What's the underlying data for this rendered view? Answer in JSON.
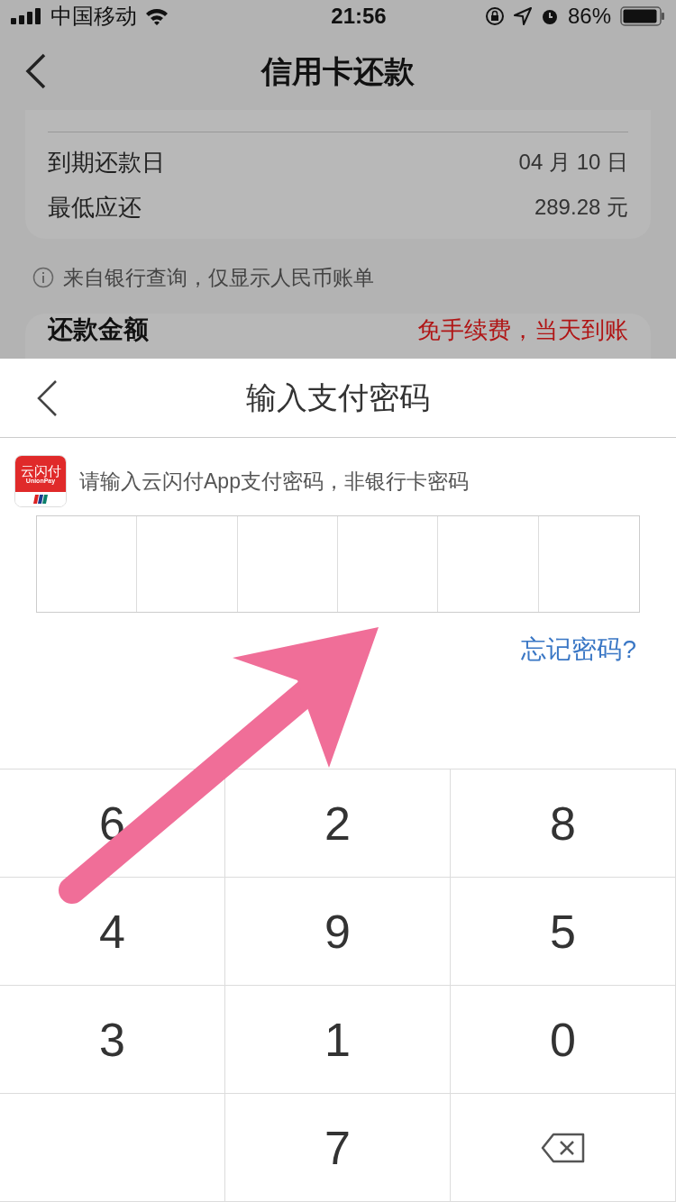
{
  "status_bar": {
    "carrier": "中国移动",
    "time": "21:56",
    "battery": "86%"
  },
  "nav": {
    "title": "信用卡还款"
  },
  "background": {
    "rows": [
      {
        "label": "到期还款日",
        "value": "04 月 10 日"
      },
      {
        "label": "最低应还",
        "value": "289.28 元"
      }
    ],
    "notice": "来自银行查询，仅显示人民币账单",
    "amount_card": {
      "title": "还款金额",
      "note": "免手续费，当天到账"
    }
  },
  "sheet": {
    "title": "输入支付密码",
    "logo": {
      "name": "云闪付",
      "subtitle": "UnionPay"
    },
    "hint": "请输入云闪付App支付密码，非银行卡密码",
    "cells": [
      {
        "filled": false
      },
      {
        "filled": false
      },
      {
        "filled": false
      },
      {
        "filled": false
      },
      {
        "filled": false
      },
      {
        "filled": false
      }
    ],
    "forgot_link": "忘记密码?"
  },
  "keypad": [
    {
      "kind": "digit",
      "label": "6"
    },
    {
      "kind": "digit",
      "label": "2"
    },
    {
      "kind": "digit",
      "label": "8"
    },
    {
      "kind": "digit",
      "label": "4"
    },
    {
      "kind": "digit",
      "label": "9"
    },
    {
      "kind": "digit",
      "label": "5"
    },
    {
      "kind": "digit",
      "label": "3"
    },
    {
      "kind": "digit",
      "label": "1"
    },
    {
      "kind": "digit",
      "label": "0"
    },
    {
      "kind": "blank"
    },
    {
      "kind": "digit",
      "label": "7"
    },
    {
      "kind": "delete"
    }
  ],
  "annotation": {
    "kind": "arrow"
  }
}
